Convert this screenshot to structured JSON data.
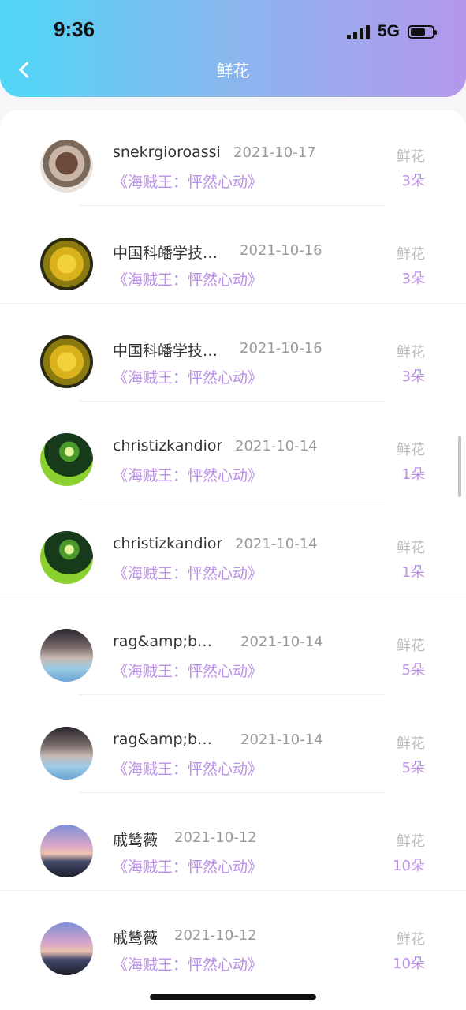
{
  "status_bar": {
    "time": "9:36",
    "network": "5G",
    "battery_percent": 70
  },
  "header": {
    "title": "鲜花"
  },
  "items": [
    {
      "name": "snekrgioroassi",
      "date": "2021-10-17",
      "book": "《海贼王：怦然心动》",
      "gift_label": "鲜花",
      "count": "3朵",
      "avatar": "person-art"
    },
    {
      "name": "中国科皤学技术大学",
      "date": "2021-10-16",
      "book": "《海贼王：怦然心动》",
      "gift_label": "鲜花",
      "count": "3朵",
      "avatar": "yellow-flower"
    },
    {
      "name": "中国科皤学技术大学",
      "date": "2021-10-16",
      "book": "《海贼王：怦然心动》",
      "gift_label": "鲜花",
      "count": "3朵",
      "avatar": "yellow-flower"
    },
    {
      "name": "christizkandior",
      "date": "2021-10-14",
      "book": "《海贼王：怦然心动》",
      "gift_label": "鲜花",
      "count": "1朵",
      "avatar": "sprout"
    },
    {
      "name": "christizkandior",
      "date": "2021-10-14",
      "book": "《海贼王：怦然心动》",
      "gift_label": "鲜花",
      "count": "1朵",
      "avatar": "sprout"
    },
    {
      "name": "rag&amp;b…",
      "date": "2021-10-14",
      "book": "《海贼王：怦然心动》",
      "gift_label": "鲜花",
      "count": "5朵",
      "avatar": "sky-text"
    },
    {
      "name": "rag&amp;b…",
      "date": "2021-10-14",
      "book": "《海贼王：怦然心动》",
      "gift_label": "鲜花",
      "count": "5朵",
      "avatar": "sky-text"
    },
    {
      "name": "戚鸶薇",
      "date": "2021-10-12",
      "book": "《海贼王：怦然心动》",
      "gift_label": "鲜花",
      "count": "10朵",
      "avatar": "sunset-pose"
    },
    {
      "name": "戚鸶薇",
      "date": "2021-10-12",
      "book": "《海贼王：怦然心动》",
      "gift_label": "鲜花",
      "count": "10朵",
      "avatar": "sunset-pose"
    }
  ]
}
